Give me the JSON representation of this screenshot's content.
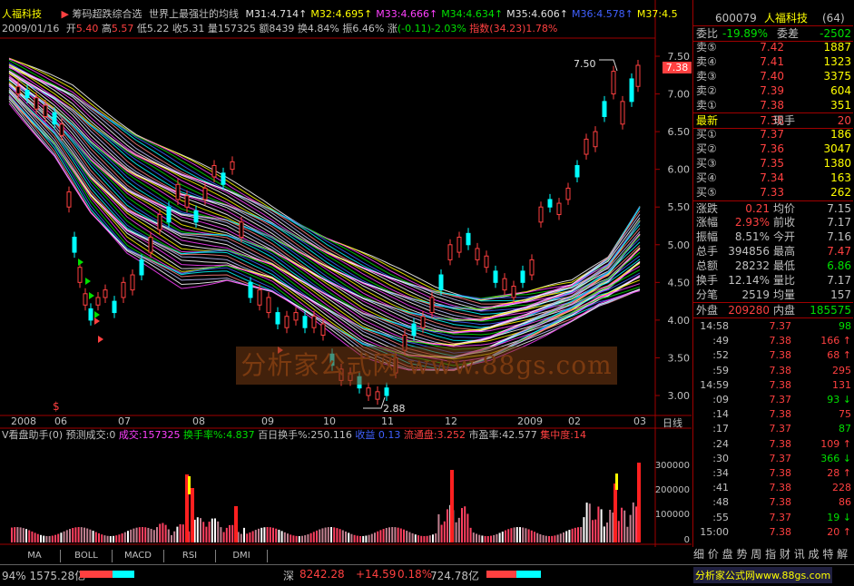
{
  "header": {
    "stock_name": "人福科技",
    "indicator_name": "筹码超跌综合选",
    "formula_title": "世界上最强壮的均线",
    "ma_values": [
      {
        "label": "M31:4.714",
        "arrow": "↑",
        "color": "#e0e0e0"
      },
      {
        "label": "M32:4.695",
        "arrow": "↑",
        "color": "#ffff00"
      },
      {
        "label": "M33:4.666",
        "arrow": "↑",
        "color": "#ff40ff"
      },
      {
        "label": "M34:4.634",
        "arrow": "↑",
        "color": "#00e000"
      },
      {
        "label": "M35:4.606",
        "arrow": "↑",
        "color": "#e0e0e0"
      },
      {
        "label": "M36:4.578",
        "arrow": "↑",
        "color": "#4060ff"
      },
      {
        "label": "M37:4.5",
        "arrow": "",
        "color": "#ffff00"
      }
    ]
  },
  "info": {
    "date": "2009/01/16",
    "open_label": "开",
    "open": "5.40",
    "high_label": "高",
    "high": "5.57",
    "low_label": "低",
    "low": "5.22",
    "close_label": "收",
    "close": "5.31",
    "volume_label": "量",
    "volume": "157325",
    "amount_label": "额",
    "amount": "8439",
    "turnover_label": "换",
    "turnover": "4.84%",
    "amplitude_label": "振",
    "amplitude": "6.46%",
    "change_label": "涨",
    "change": "(-0.11)-2.03%",
    "index_label": "指数",
    "index": "(34.23)1.78%"
  },
  "price_axis": {
    "ticks": [
      "7.50",
      "7.00",
      "6.50",
      "6.00",
      "5.50",
      "5.00",
      "4.50",
      "4.00",
      "3.50",
      "3.00"
    ],
    "current_tag": "7.38",
    "high_mark": "7.50",
    "low_mark": "2.88"
  },
  "time_axis": {
    "labels": [
      "2008",
      "06",
      "07",
      "08",
      "09",
      "10",
      "11",
      "12",
      "2009",
      "02",
      "03"
    ],
    "period": "日线"
  },
  "watermark": "分析家公式网 www.88gs.com",
  "volume_panel": {
    "title": "V看盘助手(0)",
    "predict": "预测成交:0",
    "vol_label": "成交:157325",
    "turnover_rate": "换手率%:4.837",
    "hundred_day": "百日换手%:250.116",
    "profit": "收益 0.13",
    "float_cap": "流通盘:3.252",
    "pe": "市盈率:42.577",
    "concentration": "集中度:14",
    "axis_ticks": [
      "300000",
      "200000",
      "100000",
      "0"
    ]
  },
  "bottom_tabs": [
    "MA",
    "BOLL",
    "MACD",
    "RSI",
    "DMI"
  ],
  "quote": {
    "code": "600079",
    "name": "人福科技",
    "suffix": "(64)",
    "weibi_label": "委比",
    "weibi": "-19.89%",
    "weicha_label": "委差",
    "weicha": "-2502",
    "asks": [
      {
        "label": "卖⑤",
        "price": "7.42",
        "vol": "1887"
      },
      {
        "label": "卖④",
        "price": "7.41",
        "vol": "1323"
      },
      {
        "label": "卖③",
        "price": "7.40",
        "vol": "3375"
      },
      {
        "label": "卖②",
        "price": "7.39",
        "vol": "604"
      },
      {
        "label": "卖①",
        "price": "7.38",
        "vol": "351"
      }
    ],
    "last_label": "最新",
    "last": "7.38",
    "cur_hand_label": "现手",
    "cur_hand": "20",
    "bids": [
      {
        "label": "买①",
        "price": "7.37",
        "vol": "186"
      },
      {
        "label": "买②",
        "price": "7.36",
        "vol": "3047"
      },
      {
        "label": "买③",
        "price": "7.35",
        "vol": "1380"
      },
      {
        "label": "买④",
        "price": "7.34",
        "vol": "163"
      },
      {
        "label": "买⑤",
        "price": "7.33",
        "vol": "262"
      }
    ],
    "stats": [
      {
        "l1": "涨跌",
        "v1": "0.21",
        "l2": "均价",
        "v2": "7.15",
        "c1": "#ff4040",
        "c2": "#c0c0c0"
      },
      {
        "l1": "涨幅",
        "v1": "2.93%",
        "l2": "前收",
        "v2": "7.17",
        "c1": "#ff4040",
        "c2": "#c0c0c0"
      },
      {
        "l1": "振幅",
        "v1": "8.51%",
        "l2": "今开",
        "v2": "7.16",
        "c1": "#c0c0c0",
        "c2": "#c0c0c0"
      },
      {
        "l1": "总手",
        "v1": "394856",
        "l2": "最高",
        "v2": "7.47",
        "c1": "#c0c0c0",
        "c2": "#ff4040"
      },
      {
        "l1": "总额",
        "v1": "28232",
        "l2": "最低",
        "v2": "6.86",
        "c1": "#c0c0c0",
        "c2": "#00e000"
      },
      {
        "l1": "换手",
        "v1": "12.14%",
        "l2": "量比",
        "v2": "7.17",
        "c1": "#c0c0c0",
        "c2": "#c0c0c0"
      },
      {
        "l1": "分笔",
        "v1": "2519",
        "l2": "均量",
        "v2": "157",
        "c1": "#c0c0c0",
        "c2": "#c0c0c0"
      }
    ],
    "outer_label": "外盘",
    "outer": "209280",
    "inner_label": "内盘",
    "inner": "185575"
  },
  "ticks": [
    {
      "t": "14:58",
      "p": "7.37",
      "v": "98",
      "a": "",
      "pc": "#ff4040",
      "vc": "#00e000"
    },
    {
      "t": ":49",
      "p": "7.38",
      "v": "166",
      "a": "↑",
      "pc": "#ff4040",
      "vc": "#ff4040"
    },
    {
      "t": ":52",
      "p": "7.38",
      "v": "68",
      "a": "↑",
      "pc": "#ff4040",
      "vc": "#ff4040"
    },
    {
      "t": ":59",
      "p": "7.38",
      "v": "295",
      "a": "",
      "pc": "#ff4040",
      "vc": "#ff4040"
    },
    {
      "t": "14:59",
      "p": "7.38",
      "v": "131",
      "a": "",
      "pc": "#ff4040",
      "vc": "#ff4040"
    },
    {
      "t": ":09",
      "p": "7.37",
      "v": "93",
      "a": "↓",
      "pc": "#ff4040",
      "vc": "#00e000"
    },
    {
      "t": ":14",
      "p": "7.38",
      "v": "75",
      "a": "",
      "pc": "#ff4040",
      "vc": "#ff4040"
    },
    {
      "t": ":17",
      "p": "7.37",
      "v": "87",
      "a": "",
      "pc": "#ff4040",
      "vc": "#00e000"
    },
    {
      "t": ":24",
      "p": "7.38",
      "v": "109",
      "a": "↑",
      "pc": "#ff4040",
      "vc": "#ff4040"
    },
    {
      "t": ":30",
      "p": "7.37",
      "v": "366",
      "a": "↓",
      "pc": "#ff4040",
      "vc": "#00e000"
    },
    {
      "t": ":34",
      "p": "7.38",
      "v": "28",
      "a": "↑",
      "pc": "#ff4040",
      "vc": "#ff4040"
    },
    {
      "t": ":41",
      "p": "7.38",
      "v": "228",
      "a": "",
      "pc": "#ff4040",
      "vc": "#ff4040"
    },
    {
      "t": ":48",
      "p": "7.38",
      "v": "86",
      "a": "",
      "pc": "#ff4040",
      "vc": "#ff4040"
    },
    {
      "t": ":55",
      "p": "7.37",
      "v": "19",
      "a": "↓",
      "pc": "#ff4040",
      "vc": "#00e000"
    },
    {
      "t": "15:00",
      "p": "7.38",
      "v": "20",
      "a": "↑",
      "pc": "#ff4040",
      "vc": "#ff4040"
    }
  ],
  "right_bottom_tabs": "细 价 盘 势 周 指 财 讯 成 特 解",
  "status": {
    "left_index": "94% 1575.28亿",
    "sz_label": "深",
    "sz_value": "8242.28",
    "sz_change": "+14.59",
    "sz_pct": "0.18%",
    "sz_amount": "724.78亿",
    "site": "分析家公式网www.88gs.com"
  }
}
